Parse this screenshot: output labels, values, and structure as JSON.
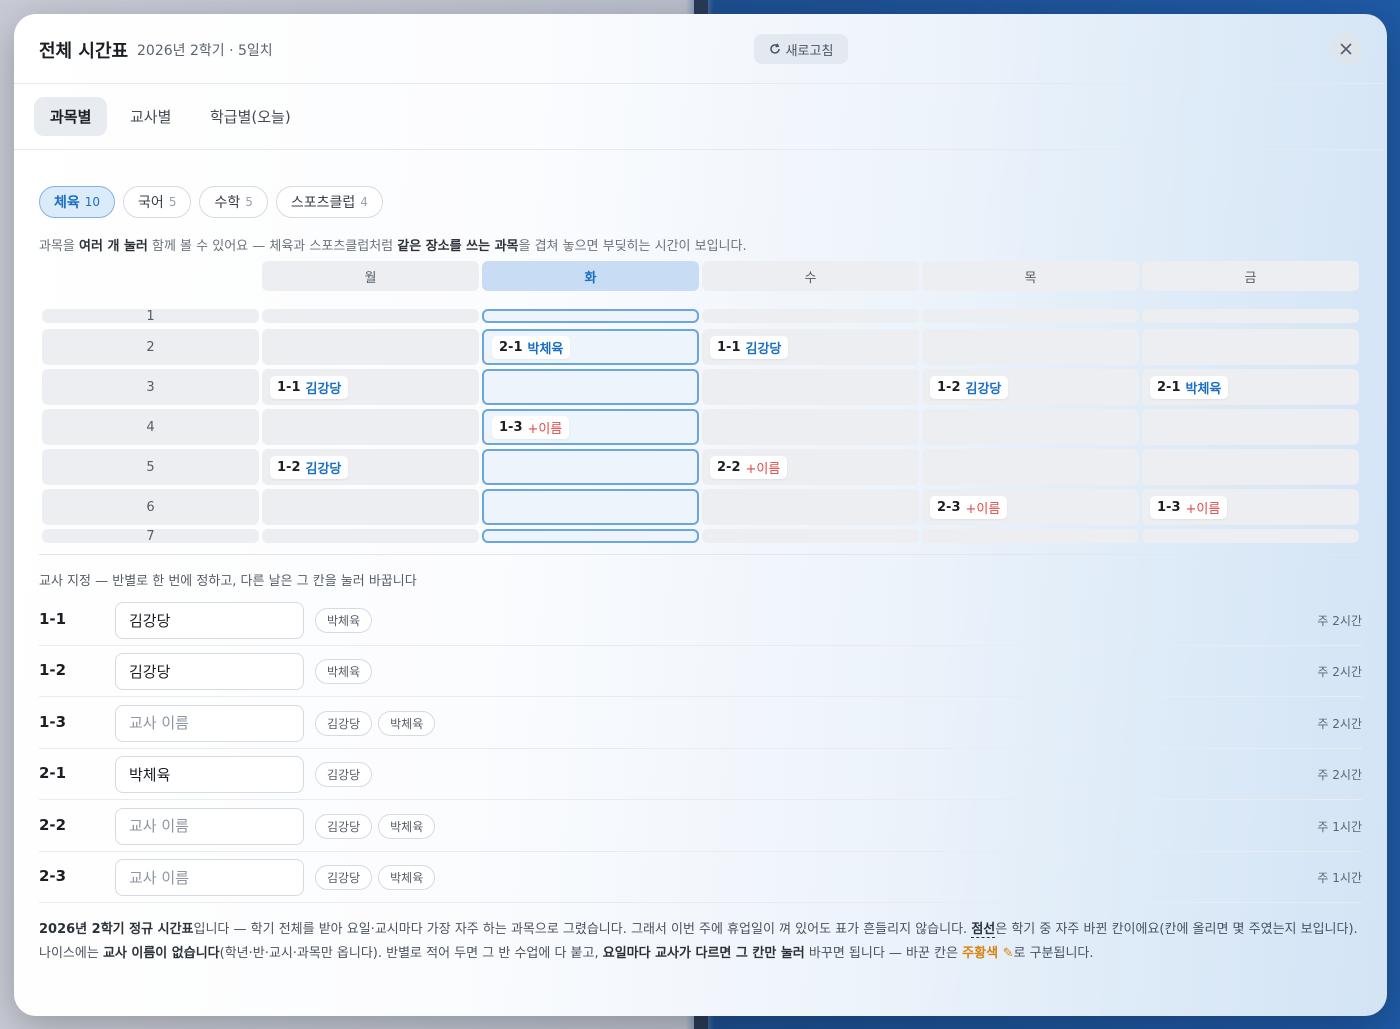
{
  "header": {
    "title": "전체 시간표",
    "subtitle": "2026년 2학기 · 5일치",
    "refresh_label": "새로고침"
  },
  "tabs": [
    {
      "label": "과목별",
      "active": true
    },
    {
      "label": "교사별",
      "active": false
    },
    {
      "label": "학급별(오늘)",
      "active": false
    }
  ],
  "subject_chips": [
    {
      "label": "체육",
      "count": "10",
      "active": true
    },
    {
      "label": "국어",
      "count": "5",
      "active": false
    },
    {
      "label": "수학",
      "count": "5",
      "active": false
    },
    {
      "label": "스포츠클럽",
      "count": "4",
      "active": false
    }
  ],
  "hint": {
    "p1": "과목을 ",
    "b1": "여러 개 눌러",
    "p2": " 함께 볼 수 있어요 — 체육과 스포츠클럽처럼 ",
    "b2": "같은 장소를 쓰는 과목",
    "p3": "을 겹쳐 놓으면 부딪히는 시간이 보입니다."
  },
  "timetable": {
    "days": [
      "월",
      "화",
      "수",
      "목",
      "금"
    ],
    "selected_day": "화",
    "periods": [
      "1",
      "2",
      "3",
      "4",
      "5",
      "6",
      "7"
    ],
    "entries": [
      {
        "period": "2",
        "day": "화",
        "class": "2-1",
        "teacher": "박체육",
        "assigned": true
      },
      {
        "period": "2",
        "day": "수",
        "class": "1-1",
        "teacher": "김강당",
        "assigned": true
      },
      {
        "period": "3",
        "day": "월",
        "class": "1-1",
        "teacher": "김강당",
        "assigned": true
      },
      {
        "period": "3",
        "day": "목",
        "class": "1-2",
        "teacher": "김강당",
        "assigned": true
      },
      {
        "period": "3",
        "day": "금",
        "class": "2-1",
        "teacher": "박체육",
        "assigned": true
      },
      {
        "period": "4",
        "day": "화",
        "class": "1-3",
        "teacher": "+이름",
        "assigned": false
      },
      {
        "period": "5",
        "day": "월",
        "class": "1-2",
        "teacher": "김강당",
        "assigned": true
      },
      {
        "period": "5",
        "day": "수",
        "class": "2-2",
        "teacher": "+이름",
        "assigned": false
      },
      {
        "period": "6",
        "day": "목",
        "class": "2-3",
        "teacher": "+이름",
        "assigned": false
      },
      {
        "period": "6",
        "day": "금",
        "class": "1-3",
        "teacher": "+이름",
        "assigned": false
      }
    ]
  },
  "teacher_section": {
    "title": "교사 지정 — 반별로 한 번에 정하고, 다른 날은 그 칸을 눌러 바꿉니다",
    "placeholder": "교사 이름",
    "rows": [
      {
        "class": "1-1",
        "value": "김강당",
        "suggestions": [
          "박체육"
        ],
        "hours": "주 2시간"
      },
      {
        "class": "1-2",
        "value": "김강당",
        "suggestions": [
          "박체육"
        ],
        "hours": "주 2시간"
      },
      {
        "class": "1-3",
        "value": "",
        "suggestions": [
          "김강당",
          "박체육"
        ],
        "hours": "주 2시간"
      },
      {
        "class": "2-1",
        "value": "박체육",
        "suggestions": [
          "김강당"
        ],
        "hours": "주 2시간"
      },
      {
        "class": "2-2",
        "value": "",
        "suggestions": [
          "김강당",
          "박체육"
        ],
        "hours": "주 1시간"
      },
      {
        "class": "2-3",
        "value": "",
        "suggestions": [
          "김강당",
          "박체육"
        ],
        "hours": "주 1시간"
      }
    ]
  },
  "footer": {
    "b1": "2026년 2학기 정규 시간표",
    "p1": "입니다 — 학기 전체를 받아 요일·교시마다 가장 자주 하는 과목으로 그렸습니다. 그래서 이번 주에 휴업일이 껴 있어도 표가 흔들리지 않습니다. ",
    "u1": "점선",
    "p2": "은 학기 중 자주 바뀐 칸이에요(칸에 올리면 몇 주였는지 보입니다).",
    "p3": "나이스에는 ",
    "b2": "교사 이름이 없습니다",
    "p4": "(학년·반·교시·과목만 옵니다). 반별로 적어 두면 그 반 수업에 다 붙고, ",
    "b3": "요일마다 교사가 다르면 그 칸만 눌러",
    "p5": " 바꾸면 됩니다 — 바꾼 칸은 ",
    "o1": "주황색 ✎",
    "p6": "로 구분됩니다."
  },
  "colors": {
    "accent": "#1a6fc4",
    "warning": "#e04848",
    "changed": "#d9820e"
  }
}
